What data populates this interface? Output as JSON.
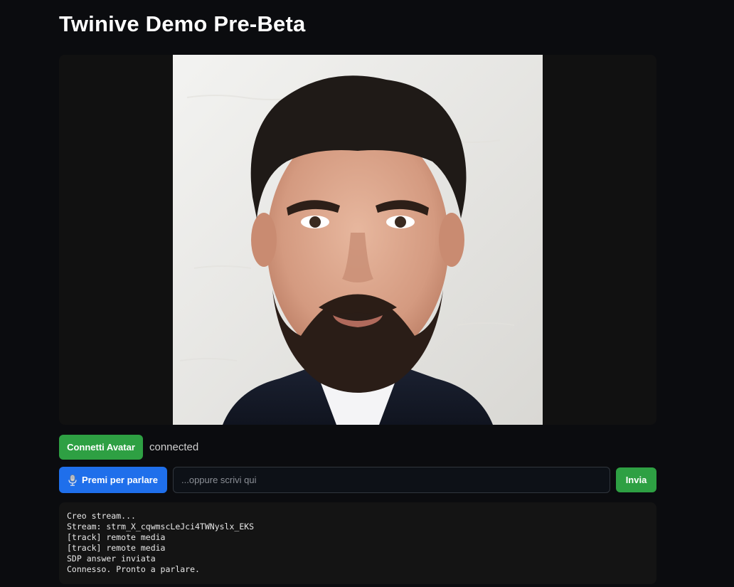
{
  "page": {
    "title": "Twinive Demo Pre-Beta"
  },
  "video": {
    "avatar_alt": "avatar-portrait"
  },
  "controls": {
    "connect_label": "Connetti Avatar",
    "status": "connected",
    "talk_label": "Premi per parlare",
    "talk_icon": "microphone-icon",
    "input_value": "",
    "input_placeholder": "...oppure scrivi qui",
    "send_label": "Invia"
  },
  "log": {
    "lines": [
      "Creo stream...",
      "Stream: strm_X_cqwmscLeJci4TWNyslx_EKS",
      "[track] remote media",
      "[track] remote media",
      "SDP answer inviata",
      "Connesso. Pronto a parlare."
    ]
  },
  "colors": {
    "background": "#0b0c0f",
    "primary_green": "#2ea043",
    "primary_blue": "#1f6feb",
    "panel": "#111111"
  }
}
